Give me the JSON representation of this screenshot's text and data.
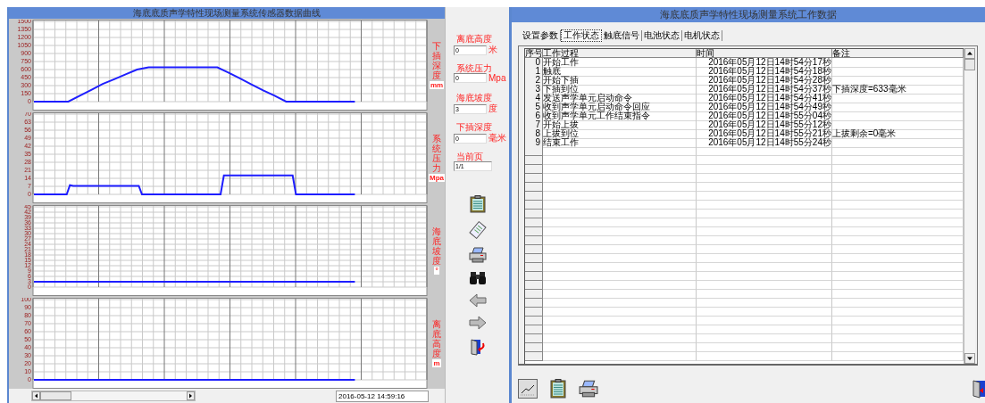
{
  "sensor_panel": {
    "title": "海底底质声学特性现场测量系统传感器数据曲线",
    "charts": [
      {
        "unit": "mm",
        "chart_data": {
          "type": "line",
          "categories": [
            null,
            null,
            null,
            null,
            null,
            null,
            null,
            null,
            null,
            null,
            null,
            null,
            null,
            null,
            null,
            null,
            null,
            null,
            null,
            null,
            null,
            null,
            null,
            null,
            null,
            null,
            null,
            null,
            null
          ],
          "series": [
            {
              "name": "下插深度",
              "color": "#1e1eff",
              "values": [
                0,
                0,
                0,
                0,
                110,
                220,
                330,
                420,
                510,
                600,
                640,
                640,
                640,
                640,
                640,
                640,
                640,
                540,
                430,
                320,
                210,
                110,
                0,
                0,
                0,
                0,
                0,
                0,
                0
              ]
            }
          ],
          "grid": true,
          "ylim": [
            0,
            1500
          ],
          "yticks": [
            0,
            150,
            300,
            450,
            600,
            750,
            900,
            1050,
            1200,
            1350,
            1500
          ]
        }
      },
      {
        "unit": "Mpa",
        "chart_data": {
          "type": "line",
          "categories": [
            null,
            null,
            null,
            null,
            null,
            null,
            null,
            null,
            null,
            null,
            null,
            null,
            null,
            null,
            null,
            null,
            null,
            null,
            null,
            null,
            null,
            null,
            null,
            null,
            null,
            null,
            null,
            null,
            null,
            null,
            null,
            null,
            null,
            null,
            null,
            null,
            null,
            null,
            null,
            null,
            null,
            null,
            null,
            null,
            null,
            null,
            null,
            null,
            null,
            null,
            null,
            null,
            null,
            null,
            null,
            null,
            null,
            null,
            null,
            null,
            null,
            null,
            null,
            null,
            null,
            null,
            null,
            null,
            null,
            null,
            null,
            null,
            null,
            null,
            null,
            null,
            null,
            null,
            null,
            null,
            null,
            null,
            null,
            null,
            null,
            null,
            null,
            null,
            null,
            null,
            null,
            null,
            null,
            null,
            null,
            null,
            null,
            null,
            null
          ],
          "series": [
            {
              "name": "系统压力",
              "color": "#1e1eff",
              "values": [
                0,
                0,
                0,
                0,
                0,
                0,
                0,
                0,
                0,
                0,
                0,
                8,
                7.5,
                7.5,
                7.5,
                7.5,
                7.5,
                7.5,
                7.5,
                7.5,
                7.5,
                7.5,
                7.5,
                7.5,
                7.5,
                7.5,
                7.5,
                7.5,
                7.5,
                7.5,
                7.5,
                7.5,
                7.5,
                0,
                0,
                0,
                0,
                0,
                0,
                0,
                0,
                0,
                0,
                0,
                0,
                0,
                0,
                0,
                0,
                0,
                0,
                0,
                0,
                0,
                0,
                0,
                0,
                0,
                16.5,
                16.5,
                16.5,
                16.5,
                16.5,
                16.5,
                16.5,
                16.5,
                16.5,
                16.5,
                16.5,
                16.5,
                16.5,
                16.5,
                16.5,
                16.5,
                16.5,
                16.5,
                16.5,
                16.5,
                16.5,
                16.5,
                0,
                0,
                0,
                0,
                0,
                0,
                0,
                0,
                0,
                0,
                0,
                0,
                0,
                0,
                0,
                0,
                0,
                0,
                0
              ]
            }
          ],
          "grid": true,
          "ylim": [
            0,
            70
          ],
          "yticks": [
            0,
            7,
            14,
            21,
            28,
            35,
            42,
            49,
            56,
            63,
            70
          ]
        }
      },
      {
        "unit": "°",
        "chart_data": {
          "type": "line",
          "categories": [
            null,
            null,
            null,
            null,
            null,
            null,
            null,
            null,
            null,
            null,
            null,
            null,
            null,
            null,
            null,
            null,
            null,
            null,
            null,
            null,
            null,
            null,
            null,
            null,
            null,
            null,
            null,
            null,
            null
          ],
          "series": [
            {
              "name": "海底坡度",
              "color": "#1e1eff",
              "values": [
                3,
                3,
                3,
                3,
                3,
                3,
                3,
                3,
                3,
                3,
                3,
                3,
                3,
                3,
                3,
                3,
                3,
                3,
                3,
                3,
                3,
                3,
                3,
                3,
                3,
                3,
                3,
                3,
                3
              ]
            }
          ],
          "grid": true,
          "ylim": [
            0,
            45
          ],
          "yticks": [
            0,
            3,
            6,
            9,
            12,
            15,
            18,
            21,
            24,
            27,
            30,
            33,
            36,
            39,
            42,
            45
          ]
        }
      },
      {
        "unit": "m",
        "chart_data": {
          "type": "line",
          "categories": [
            null,
            null,
            null,
            null,
            null,
            null,
            null,
            null,
            null,
            null,
            null,
            null,
            null,
            null,
            null,
            null,
            null,
            null,
            null,
            null,
            null,
            null,
            null,
            null,
            null,
            null,
            null,
            null,
            null
          ],
          "series": [
            {
              "name": "离底高度",
              "color": "#1e1eff",
              "values": [
                0,
                0,
                0,
                0,
                0,
                0,
                0,
                0,
                0,
                0,
                0,
                0,
                0,
                0,
                0,
                0,
                0,
                0,
                0,
                0,
                0,
                0,
                0,
                0,
                0,
                0,
                0,
                0,
                0
              ]
            }
          ],
          "grid": true,
          "ylim": [
            0,
            100
          ],
          "yticks": [
            0,
            10,
            20,
            30,
            40,
            50,
            60,
            70,
            80,
            90,
            100
          ]
        }
      }
    ],
    "timestamp": "2016-05-12 14:59:16"
  },
  "readouts": [
    {
      "label": "离底高度",
      "value": "0",
      "unit": "米"
    },
    {
      "label": "系统压力",
      "value": "0",
      "unit": "Mpa"
    },
    {
      "label": "海底坡度",
      "value": "3",
      "unit": "度"
    },
    {
      "label": "下插深度",
      "value": "0",
      "unit": "毫米"
    },
    {
      "label": "当前页",
      "value": "1/1"
    }
  ],
  "work_panel": {
    "title": "海底底质声学特性现场测量系统工作数据",
    "tabs": [
      {
        "label": "设置参数",
        "selected": false
      },
      {
        "label": "工作状态",
        "selected": true
      },
      {
        "label": "触底信号",
        "selected": false
      },
      {
        "label": "电池状态",
        "selected": false
      },
      {
        "label": "电机状态",
        "selected": false
      }
    ],
    "table": {
      "columns": [
        "序号",
        "工作过程",
        "时间",
        "备注"
      ],
      "rows": [
        {
          "no": "0",
          "process": "开始工作",
          "time": "2016年05月12日14时54分17秒"
        },
        {
          "no": "1",
          "process": "触底",
          "time": "2016年05月12日14时54分18秒"
        },
        {
          "no": "2",
          "process": "开始下插",
          "time": "2016年05月12日14时54分28秒"
        },
        {
          "no": "3",
          "process": "下插到位",
          "time": "2016年05月12日14时54分37秒",
          "note": "下插深度=633毫米"
        },
        {
          "no": "4",
          "process": "发送声学单元启动命令",
          "time": "2016年05月12日14时54分41秒"
        },
        {
          "no": "5",
          "process": "收到声学单元启动命令回应",
          "time": "2016年05月12日14时54分49秒"
        },
        {
          "no": "6",
          "process": "收到声学单元工作结束指令",
          "time": "2016年05月12日14时55分04秒"
        },
        {
          "no": "7",
          "process": "开始上拔",
          "time": "2016年05月12日14时55分12秒"
        },
        {
          "no": "8",
          "process": "上拔到位",
          "time": "2016年05月12日14时55分21秒",
          "note": "上拔剩余=0毫米"
        },
        {
          "no": "9",
          "process": "结束工作",
          "time": "2016年05月12日14时55分24秒"
        }
      ]
    }
  }
}
